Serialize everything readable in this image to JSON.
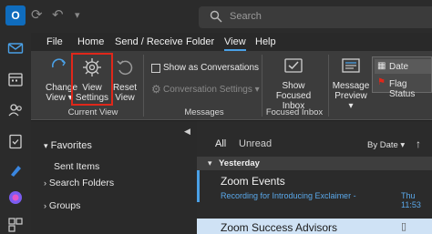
{
  "app": {
    "logo_letter": "O"
  },
  "titlebar": {
    "search_placeholder": "Search"
  },
  "menu": [
    {
      "label": "File"
    },
    {
      "label": "Home"
    },
    {
      "label": "Send / Receive"
    },
    {
      "label": "Folder"
    },
    {
      "label": "View",
      "active": true
    },
    {
      "label": "Help"
    }
  ],
  "ribbon": {
    "change_view": {
      "line1": "Change",
      "line2": "View"
    },
    "view_settings": {
      "line1": "View",
      "line2": "Settings"
    },
    "reset_view": {
      "line1": "Reset",
      "line2": "View"
    },
    "current_view_label": "Current View",
    "show_as_conversations": "Show as Conversations",
    "conversation_settings": "Conversation Settings",
    "messages_label": "Messages",
    "show_focused_inbox": {
      "line1": "Show Focused",
      "line2": "Inbox"
    },
    "focused_inbox_label": "Focused Inbox",
    "message_preview": {
      "line1": "Message",
      "line2": "Preview"
    },
    "arrangement": {
      "date": "Date",
      "flag_status": "Flag Status"
    }
  },
  "folders": {
    "favorites": "Favorites",
    "sent_items": "Sent Items",
    "search_folders": "Search Folders",
    "groups": "Groups"
  },
  "messages": {
    "tab_all": "All",
    "tab_unread": "Unread",
    "sort_label": "By Date",
    "group_header": "Yesterday",
    "items": [
      {
        "sender": "Zoom Events",
        "subject": "Recording for Introducing Exclaimer -",
        "time": "Thu 11:53"
      },
      {
        "sender": "Zoom Success Advisors",
        "subject": "",
        "time": ""
      }
    ]
  },
  "colors": {
    "accent": "#4aa0e6",
    "highlight_border": "#e0271a",
    "selected_row": "#cfe2f5"
  }
}
